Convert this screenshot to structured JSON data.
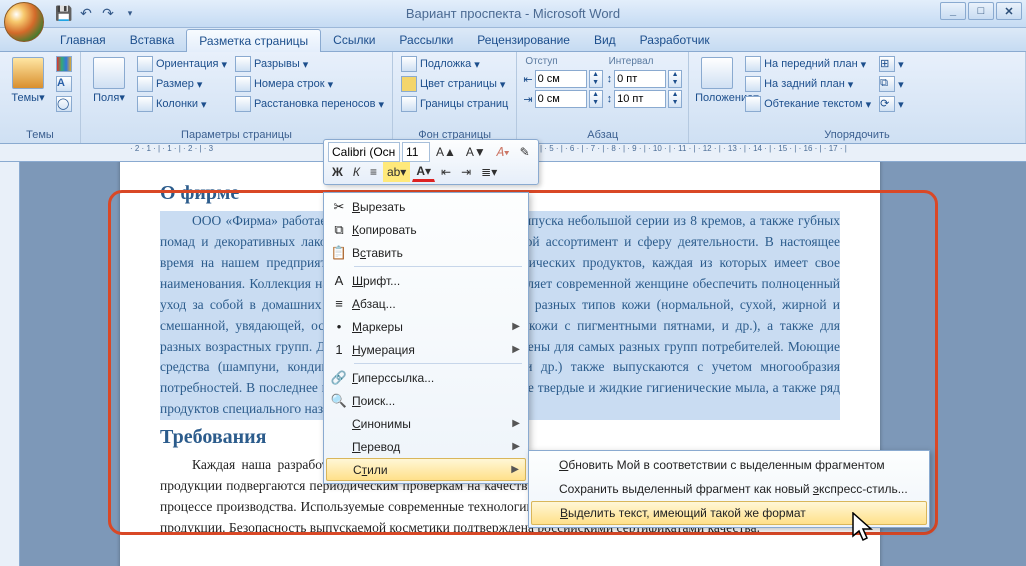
{
  "window": {
    "title": "Вариант проспекта - Microsoft Word"
  },
  "tabs": [
    "Главная",
    "Вставка",
    "Разметка страницы",
    "Ссылки",
    "Рассылки",
    "Рецензирование",
    "Вид",
    "Разработчик"
  ],
  "active_tab": 2,
  "groups": {
    "themes": {
      "label": "Темы",
      "btn": "Темы"
    },
    "page_setup": {
      "label": "Параметры страницы",
      "fields": "Поля",
      "orientation": "Ориентация",
      "size": "Размер",
      "columns": "Колонки",
      "breaks": "Разрывы",
      "line_numbers": "Номера строк",
      "hyphenation": "Расстановка переносов"
    },
    "page_bg": {
      "label": "Фон страницы",
      "watermark": "Подложка",
      "page_color": "Цвет страницы",
      "page_borders": "Границы страниц"
    },
    "paragraph": {
      "label": "Абзац",
      "indent_label": "Отступ",
      "spacing_label": "Интервал",
      "indent_left": "0 см",
      "indent_right": "0 см",
      "spacing_before": "0 пт",
      "spacing_after": "10 пт"
    },
    "arrange": {
      "label": "Упорядочить",
      "position": "Положение",
      "bring_front": "На передний план",
      "send_back": "На задний план",
      "text_wrap": "Обтекание текстом"
    }
  },
  "mini_toolbar": {
    "font": "Calibri (Осн",
    "size": "11"
  },
  "context_menu": [
    {
      "icon": "✂",
      "label": "Вырезать",
      "u": "В"
    },
    {
      "icon": "⧉",
      "label": "Копировать",
      "u": "К"
    },
    {
      "icon": "📋",
      "label": "Вставить",
      "u": "с"
    },
    {
      "sep": true
    },
    {
      "icon": "A",
      "label": "Шрифт...",
      "u": "Ш"
    },
    {
      "icon": "≡",
      "label": "Абзац...",
      "u": "А"
    },
    {
      "icon": "•",
      "label": "Маркеры",
      "u": "М",
      "sub": true
    },
    {
      "icon": "1",
      "label": "Нумерация",
      "u": "Н",
      "sub": true
    },
    {
      "sep": true
    },
    {
      "icon": "🔗",
      "label": "Гиперссылка...",
      "u": "Г"
    },
    {
      "icon": "🔍",
      "label": "Поиск...",
      "u": "П"
    },
    {
      "icon": "",
      "label": "Синонимы",
      "u": "С",
      "sub": true
    },
    {
      "icon": "",
      "label": "Перевод",
      "u": "П",
      "sub": true
    },
    {
      "icon": "",
      "label": "Стили",
      "u": "т",
      "sub": true,
      "hl": true
    }
  ],
  "sub_menu": [
    {
      "label": "Обновить Мой в соответствии с выделенным фрагментом",
      "u": "О"
    },
    {
      "label": "Сохранить выделенный фрагмент как новый экспресс-стиль...",
      "u": "э"
    },
    {
      "label": "Выделить текст, имеющий такой же формат",
      "u": "В",
      "hl": true
    }
  ],
  "doc": {
    "h1": "О фирме",
    "p1": "ООО «Фирма» работает на рынке с 1999 года. Начав с выпуска небольшой серии из 8 кремов, а также губных помад и декоративных лаков, мы значительно расширило свой ассортимент и сферу деятельности. В настоящее время на нашем предприятии выпускается 21 линия косметических продуктов, каждая из которых имеет свое наименования. Коллекция наших косметических средств позволяет современной женщине обеспечить полноценный уход за собой в домашних условиях. Разработаны серии для разных типов кожи (нормальной, сухой, жирной и смешанной, увядающей, особо чувствительной, проблемной кожи с пигментными пятнами, и др.), а также для разных возрастных групп. Декоративная косметика предназначены для самых разных групп потребителей. Моющие средства (шампуни, кондиционеры, гели, пены для ванн, и др.) также выпускаются с учетом многообразия потребностей. В  последнее время предприятие выпускает также твердые и жидкие гигиенические мыла, а также ряд продуктов специального назначения.",
    "h2": "Требования",
    "p2": "Каждая наша разработка проходит клинические испытания, получает гигиенический сертификат. Все виды продукции подвергаются периодическим проверкам на качество составляющих и на соблюдение санитарных норм в процессе производства. Используемые современные технологии позволяют гарантировать потребительские свойства продукции. Безопасность выпускаемой косметики подтверждена российскими сертификатами качества."
  }
}
